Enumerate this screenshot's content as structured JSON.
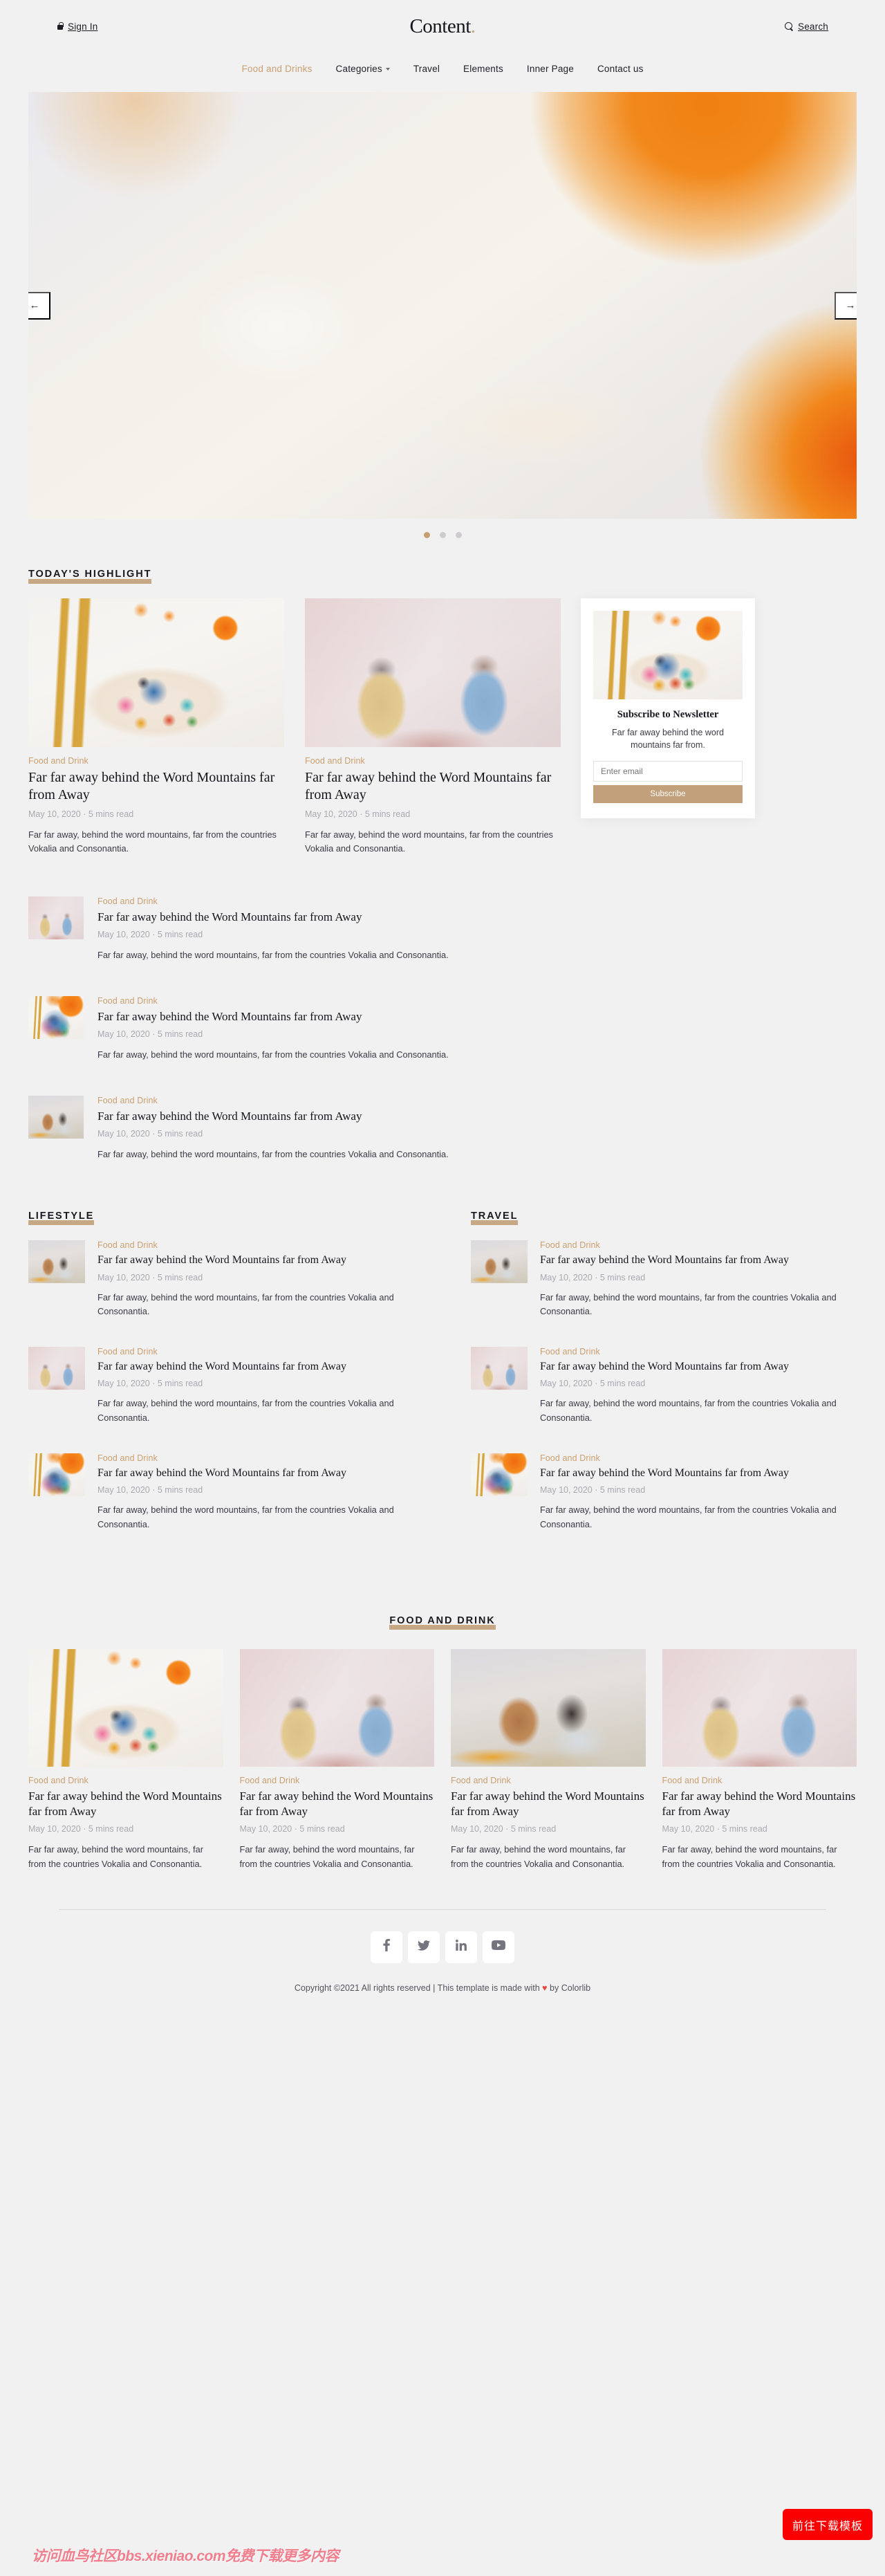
{
  "header": {
    "signin_label": "Sign In",
    "brand": "Content",
    "brand_dot": ".",
    "search_label": "Search",
    "nav": [
      {
        "label": "Food and Drinks",
        "active": true,
        "caret": false
      },
      {
        "label": "Categories",
        "active": false,
        "caret": true
      },
      {
        "label": "Travel",
        "active": false,
        "caret": false
      },
      {
        "label": "Elements",
        "active": false,
        "caret": false
      },
      {
        "label": "Inner Page",
        "active": false,
        "caret": false
      },
      {
        "label": "Contact us",
        "active": false,
        "caret": false
      }
    ]
  },
  "hero": {
    "prev_label": "←",
    "next_label": "→",
    "dots": 3,
    "active_dot": 0
  },
  "highlight": {
    "heading": "TODAY'S HIGHLIGHT",
    "cards": [
      {
        "category": "Food and Drink",
        "title": "Far far away behind the Word Mountains far from Away",
        "date": "May 10, 2020",
        "read": "5 mins read",
        "excerpt": "Far far away, behind the word mountains, far from the countries Vokalia and Consonantia.",
        "image": "img-plate"
      },
      {
        "category": "Food and Drink",
        "title": "Far far away behind the Word Mountains far from Away",
        "date": "May 10, 2020",
        "read": "5 mins read",
        "excerpt": "Far far away, behind the word mountains, far from the countries Vokalia and Consonantia.",
        "image": "img-two-women"
      }
    ]
  },
  "newsletter": {
    "title": "Subscribe to Newsletter",
    "description": "Far far away behind the word mountains far from.",
    "email_placeholder": "Enter email",
    "button_label": "Subscribe",
    "accent": "#c2a07b"
  },
  "post_list": [
    {
      "category": "Food and Drink",
      "title": "Far far away behind the Word Mountains far from Away",
      "date": "May 10, 2020",
      "read": "5 mins read",
      "excerpt": "Far far away, behind the word mountains, far from the countries Vokalia and Consonantia.",
      "image": "img-two-women"
    },
    {
      "category": "Food and Drink",
      "title": "Far far away behind the Word Mountains far from Away",
      "date": "May 10, 2020",
      "read": "5 mins read",
      "excerpt": "Far far away, behind the word mountains, far from the countries Vokalia and Consonantia.",
      "image": "img-plate"
    },
    {
      "category": "Food and Drink",
      "title": "Far far away behind the Word Mountains far from Away",
      "date": "May 10, 2020",
      "read": "5 mins read",
      "excerpt": "Far far away, behind the word mountains, far from the countries Vokalia and Consonantia.",
      "image": "img-couple"
    }
  ],
  "lifestyle": {
    "heading": "LIFESTYLE",
    "items": [
      {
        "category": "Food and Drink",
        "title": "Far far away behind the Word Mountains far from Away",
        "date": "May 10, 2020",
        "read": "5 mins read",
        "excerpt": "Far far away, behind the word mountains, far from the countries Vokalia and Consonantia.",
        "image": "img-couple"
      },
      {
        "category": "Food and Drink",
        "title": "Far far away behind the Word Mountains far from Away",
        "date": "May 10, 2020",
        "read": "5 mins read",
        "excerpt": "Far far away, behind the word mountains, far from the countries Vokalia and Consonantia.",
        "image": "img-two-women"
      },
      {
        "category": "Food and Drink",
        "title": "Far far away behind the Word Mountains far from Away",
        "date": "May 10, 2020",
        "read": "5 mins read",
        "excerpt": "Far far away, behind the word mountains, far from the countries Vokalia and Consonantia.",
        "image": "img-plate"
      }
    ]
  },
  "travel": {
    "heading": "TRAVEL",
    "items": [
      {
        "category": "Food and Drink",
        "title": "Far far away behind the Word Mountains far from Away",
        "date": "May 10, 2020",
        "read": "5 mins read",
        "excerpt": "Far far away, behind the word mountains, far from the countries Vokalia and Consonantia.",
        "image": "img-couple"
      },
      {
        "category": "Food and Drink",
        "title": "Far far away behind the Word Mountains far from Away",
        "date": "May 10, 2020",
        "read": "5 mins read",
        "excerpt": "Far far away, behind the word mountains, far from the countries Vokalia and Consonantia.",
        "image": "img-two-women"
      },
      {
        "category": "Food and Drink",
        "title": "Far far away behind the Word Mountains far from Away",
        "date": "May 10, 2020",
        "read": "5 mins read",
        "excerpt": "Far far away, behind the word mountains, far from the countries Vokalia and Consonantia.",
        "image": "img-plate"
      }
    ]
  },
  "food_and_drink": {
    "heading": "FOOD AND DRINK",
    "cards": [
      {
        "category": "Food and Drink",
        "title": "Far far away behind the Word Mountains far from Away",
        "date": "May 10, 2020",
        "read": "5 mins read",
        "excerpt": "Far far away, behind the word mountains, far from the countries Vokalia and Consonantia.",
        "image": "img-plate"
      },
      {
        "category": "Food and Drink",
        "title": "Far far away behind the Word Mountains far from Away",
        "date": "May 10, 2020",
        "read": "5 mins read",
        "excerpt": "Far far away, behind the word mountains, far from the countries Vokalia and Consonantia.",
        "image": "img-two-women"
      },
      {
        "category": "Food and Drink",
        "title": "Far far away behind the Word Mountains far from Away",
        "date": "May 10, 2020",
        "read": "5 mins read",
        "excerpt": "Far far away, behind the word mountains, far from the countries Vokalia and Consonantia.",
        "image": "img-couple"
      },
      {
        "category": "Food and Drink",
        "title": "Far far away behind the Word Mountains far from Away",
        "date": "May 10, 2020",
        "read": "5 mins read",
        "excerpt": "Far far away, behind the word mountains, far from the countries Vokalia and Consonantia.",
        "image": "img-two-women"
      }
    ]
  },
  "footer": {
    "socials": [
      {
        "name": "facebook-icon",
        "glyph": "f"
      },
      {
        "name": "twitter-icon",
        "glyph": "t"
      },
      {
        "name": "linkedin-icon",
        "glyph": "in"
      },
      {
        "name": "youtube-icon",
        "glyph": "yt"
      }
    ],
    "copyright_prefix": "Copyright ©2021 All rights reserved | This template is made with ",
    "copyright_heart": "♥",
    "copyright_suffix": " by Colorlib"
  },
  "overlay": {
    "watermark": "访问血鸟社区bbs.xieniao.com免费下载更多内容",
    "download_button": "前往下载模板",
    "download_color": "#fa0000"
  }
}
